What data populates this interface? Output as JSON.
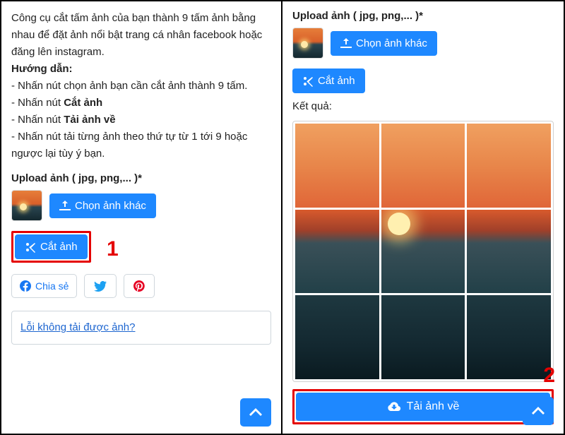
{
  "left": {
    "description": {
      "intro": "Công cụ cắt tấm ảnh của bạn thành 9 tấm ảnh bằng nhau để đặt ảnh nổi bật trang cá nhân facebook hoặc đăng lên instagram.",
      "guide_title": "Hướng dẫn:",
      "step1": "- Nhấn nút chọn ảnh bạn cần cắt ảnh thành 9 tấm.",
      "step2a": "- Nhấn nút ",
      "step2b": "Cắt ảnh",
      "step3a": "- Nhấn nút ",
      "step3b": "Tải ảnh về",
      "step4": "- Nhấn nút tải từng ảnh theo thứ tự từ 1 tới 9 hoặc ngược lại tùy ý bạn."
    },
    "upload_label": "Upload ảnh ( jpg, png,... )*",
    "choose_btn": "Chọn ảnh khác",
    "cut_btn": "Cắt ảnh",
    "step_number": "1",
    "share": {
      "fb": "Chia sẻ"
    },
    "error_link": "Lỗi không tải được ảnh?"
  },
  "right": {
    "upload_label": "Upload ảnh ( jpg, png,... )*",
    "choose_btn": "Chọn ảnh khác",
    "cut_btn": "Cắt ảnh",
    "result_label": "Kết quả:",
    "download_btn": "Tải ảnh về",
    "step_number": "2"
  }
}
